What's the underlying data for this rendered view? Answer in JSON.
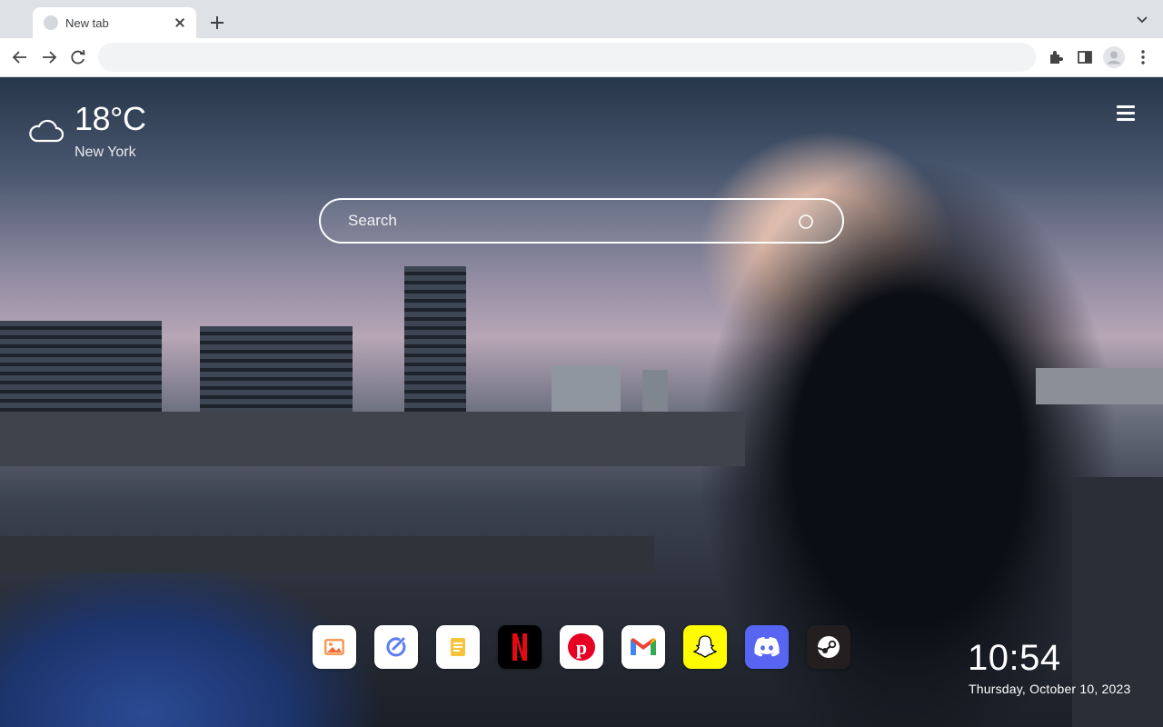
{
  "browser": {
    "tab": {
      "title": "New tab",
      "favicon": "globe-icon"
    },
    "new_tab_icon": "plus-icon",
    "tab_menu_icon": "chevron-down-icon",
    "nav": {
      "back": "arrow-left-icon",
      "forward": "arrow-right-icon",
      "reload": "reload-icon"
    },
    "address_bar": {
      "value": "",
      "placeholder": ""
    },
    "toolbar_right": [
      "puzzle-icon",
      "side-panel-icon",
      "profile-avatar",
      "kebab-menu-icon"
    ]
  },
  "page": {
    "weather": {
      "temperature": "18°C",
      "city": "New York",
      "icon": "cloud-icon"
    },
    "menu_icon": "hamburger-icon",
    "search": {
      "placeholder": "Search",
      "icon": "search-icon"
    },
    "apps": [
      {
        "name": "Photos",
        "icon": "image-icon",
        "color": "#ffffff"
      },
      {
        "name": "Tasks",
        "icon": "check-circle-icon",
        "color": "#ffffff"
      },
      {
        "name": "Notes",
        "icon": "note-icon",
        "color": "#ffffff"
      },
      {
        "name": "Netflix",
        "icon": "netflix-icon",
        "color": "#000000"
      },
      {
        "name": "Pinterest",
        "icon": "pinterest-icon",
        "color": "#ffffff"
      },
      {
        "name": "Gmail",
        "icon": "gmail-icon",
        "color": "#ffffff"
      },
      {
        "name": "Snapchat",
        "icon": "snapchat-icon",
        "color": "#fffc00"
      },
      {
        "name": "Discord",
        "icon": "discord-icon",
        "color": "#5865f2"
      },
      {
        "name": "Steam",
        "icon": "steam-icon",
        "color": "#231f20"
      }
    ],
    "clock": {
      "time": "10:54",
      "date": "Thursday, October 10, 2023"
    }
  }
}
